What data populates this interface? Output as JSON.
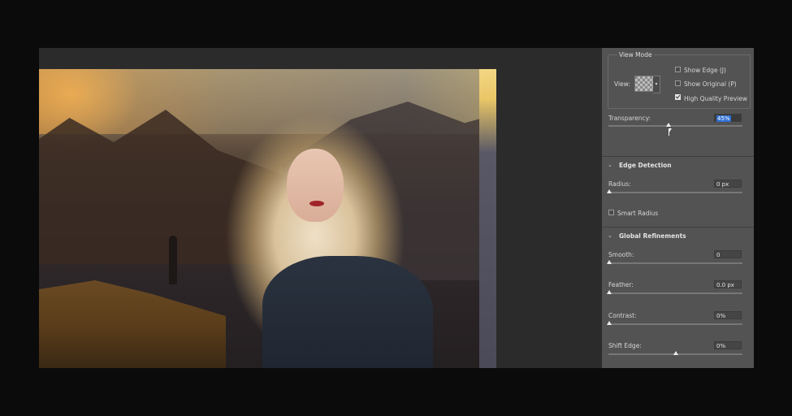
{
  "view_mode": {
    "title": "View Mode",
    "view_label": "View:",
    "show_edge": "Show Edge (J)",
    "show_edge_checked": false,
    "show_original": "Show Original (P)",
    "show_original_checked": false,
    "high_quality_preview": "High Quality Preview",
    "high_quality_preview_checked": true
  },
  "transparency": {
    "label": "Transparency:",
    "value": "45%",
    "level_percent": 45
  },
  "edge_detection": {
    "title": "Edge Detection",
    "radius_label": "Radius:",
    "radius_value": "0 px",
    "smart_radius_label": "Smart Radius",
    "smart_radius_checked": false
  },
  "global_refinements": {
    "title": "Global Refinements",
    "smooth_label": "Smooth:",
    "smooth_value": "0",
    "feather_label": "Feather:",
    "feather_value": "0.0 px",
    "contrast_label": "Contrast:",
    "contrast_value": "0%",
    "shift_edge_label": "Shift Edge:",
    "shift_edge_value": "0%"
  },
  "icons": {
    "collapse": "chevron-down-icon",
    "view_thumbnail": "checkerboard-icon",
    "cursor": "pointer-cursor-icon"
  }
}
